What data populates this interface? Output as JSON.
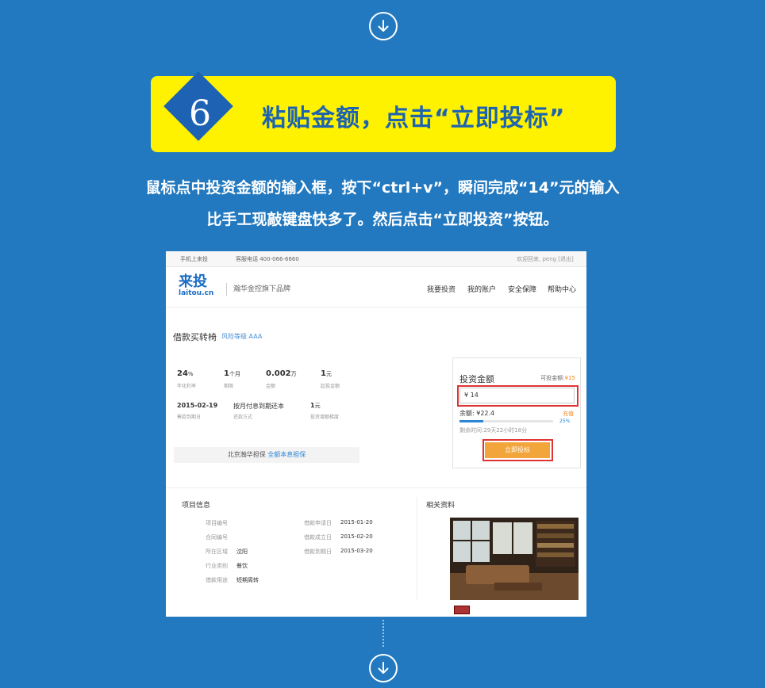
{
  "step": {
    "number": "6",
    "title": "粘贴金额，点击“立即投标”"
  },
  "description": {
    "line1": "鼠标点中投资金额的输入框，按下“ctrl+v”，瞬间完成“14”元的输入",
    "line2": "比手工现敲键盘快多了。然后点击“立即投资”按钮。"
  },
  "screenshot": {
    "topbar": {
      "mobile": "手机上来投",
      "hotline": "客服电话 400-066-6660",
      "welcome": "欢迎回来, peng [退出]"
    },
    "logo": {
      "cn": "来投",
      "en": "laitou.cn"
    },
    "slogan": "瀚华金控旗下品牌",
    "nav": [
      "我要投资",
      "我的账户",
      "安全保障",
      "帮助中心"
    ],
    "project": {
      "title": "借款买转椅",
      "risk": "风险等级 AAA"
    },
    "stats": [
      {
        "value": "24",
        "unit": "%",
        "label": "年化利率"
      },
      {
        "value": "1",
        "unit": "个月",
        "label": "期限"
      },
      {
        "value": "0.002",
        "unit": "万",
        "label": "金额"
      },
      {
        "value": "1",
        "unit": "元",
        "label": "起投金额"
      },
      {
        "value": "2015-02-19",
        "unit": "",
        "label": "筹款到期日"
      },
      {
        "value": "按月付息到期还本",
        "unit": "",
        "label": "还款方式"
      },
      {
        "value": "1",
        "unit": "元",
        "label": "投资增额梯度"
      }
    ],
    "guarantee": {
      "text": "北京瀚华担保",
      "highlight": "全额本息担保"
    },
    "invest": {
      "title": "投资金额",
      "available_label": "可投金额:",
      "available_value": "¥15",
      "input_value": "¥ 14",
      "balance": "余额: ¥22.4",
      "charge": "充值",
      "progress_percent": 25,
      "progress_label": "25%",
      "remaining": "剩余时间:29天22小时18分",
      "button": "立即投标"
    },
    "info": {
      "title": "项目信息",
      "left": [
        {
          "label": "项目编号",
          "value": ""
        },
        {
          "label": "合同编号",
          "value": ""
        },
        {
          "label": "所在区域",
          "value": "沈阳"
        },
        {
          "label": "行业类别",
          "value": "餐饮"
        },
        {
          "label": "借款用途",
          "value": "短期周转"
        }
      ],
      "right": [
        {
          "label": "借款申请日",
          "value": "2015-01-20"
        },
        {
          "label": "借款成立日",
          "value": "2015-02-20"
        },
        {
          "label": "借款到期日",
          "value": "2015-03-20"
        }
      ]
    },
    "related": {
      "title": "相关资料"
    }
  }
}
